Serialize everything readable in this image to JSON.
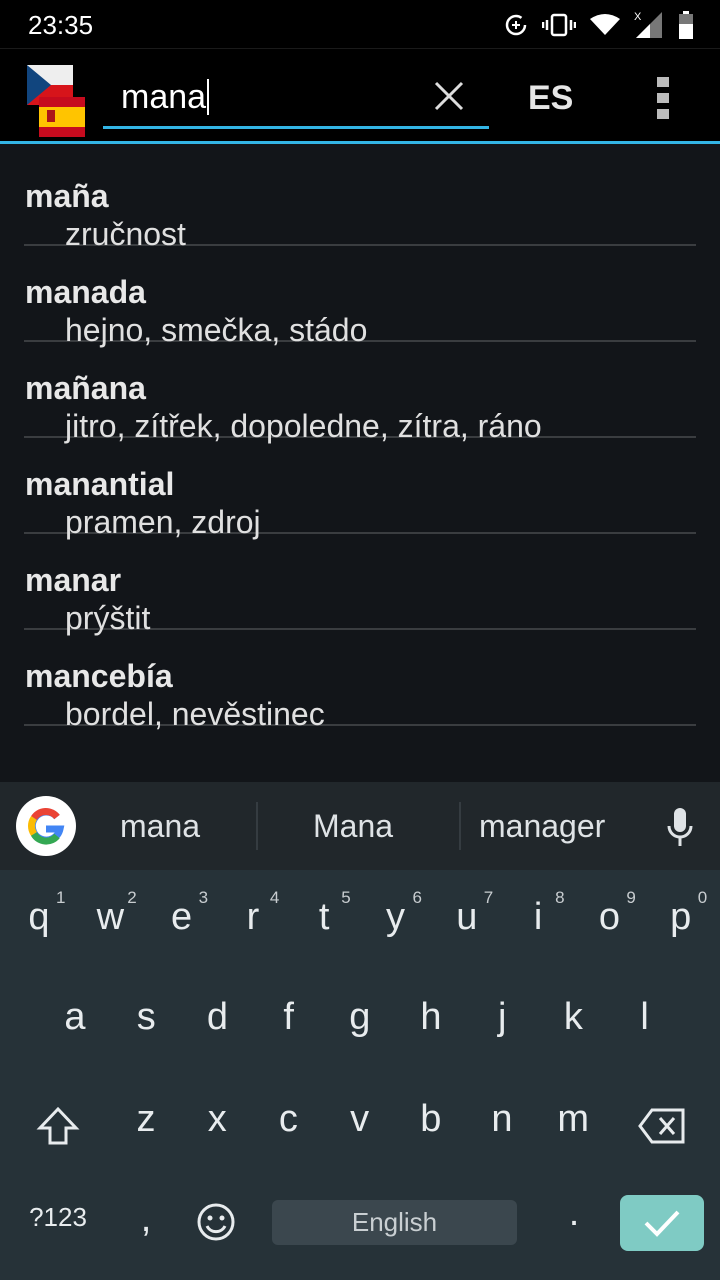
{
  "status_bar": {
    "time": "23:35",
    "icons": [
      "data-saver-icon",
      "vibrate-icon",
      "wifi-icon",
      "signal-no-data-icon",
      "battery-icon"
    ]
  },
  "app_bar": {
    "flags": [
      "czech-flag",
      "spanish-flag"
    ],
    "search_value": "mana",
    "lang_toggle": "ES",
    "accent": "#33b5e5"
  },
  "results": [
    {
      "word": "maña",
      "translation": "zručnost"
    },
    {
      "word": "manada",
      "translation": "hejno, smečka, stádo"
    },
    {
      "word": "mañana",
      "translation": "jitro, zítřek, dopoledne, zítra, ráno"
    },
    {
      "word": "manantial",
      "translation": "pramen, zdroj"
    },
    {
      "word": "manar",
      "translation": "prýštit"
    },
    {
      "word": "mancebía",
      "translation": "bordel, nevěstinec"
    }
  ],
  "keyboard": {
    "suggestions": [
      "mana",
      "Mana",
      "manager"
    ],
    "row1": [
      "q",
      "w",
      "e",
      "r",
      "t",
      "y",
      "u",
      "i",
      "o",
      "p"
    ],
    "row1_hints": [
      "1",
      "2",
      "3",
      "4",
      "5",
      "6",
      "7",
      "8",
      "9",
      "0"
    ],
    "row2": [
      "a",
      "s",
      "d",
      "f",
      "g",
      "h",
      "j",
      "k",
      "l"
    ],
    "row3": [
      "z",
      "x",
      "c",
      "v",
      "b",
      "n",
      "m"
    ],
    "symbols_key": "?123",
    "comma": ",",
    "space_label": "English",
    "period": "."
  }
}
